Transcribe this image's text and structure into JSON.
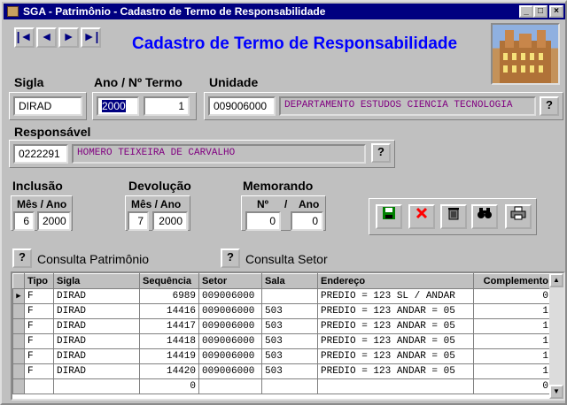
{
  "window": {
    "title": "SGA - Patrimônio - Cadastro de Termo de Responsabilidade",
    "controls": {
      "minimize": "_",
      "maximize": "□",
      "close": "×"
    }
  },
  "nav": {
    "first": "|◄",
    "prev": "◄",
    "next": "►",
    "last": "►|"
  },
  "heading": "Cadastro de Termo de Responsabilidade",
  "form": {
    "sigla_label": "Sigla",
    "sigla_value": "DIRAD",
    "ano_termo_label": "Ano  /  Nº Termo",
    "ano_value": "2000",
    "termo_value": "1",
    "unidade_label": "Unidade",
    "unidade_code": "009006000",
    "unidade_name": "DEPARTAMENTO ESTUDOS CIENCIA TECNOLOGIA",
    "responsavel_label": "Responsável",
    "responsavel_code": "0222291",
    "responsavel_name": "HOMERO TEIXEIRA DE CARVALHO",
    "inclusao_label": "Inclusão",
    "inclusao_sub": "Mês / Ano",
    "inclusao_mes": "6",
    "inclusao_ano": "2000",
    "devolucao_label": "Devolução",
    "devolucao_sub": "Mês / Ano",
    "devolucao_mes": "7",
    "devolucao_ano": "2000",
    "memorando_label": "Memorando",
    "memorando_sub_n": "Nº",
    "memorando_sub_sep": "/",
    "memorando_sub_ano": "Ano",
    "memorando_n": "0",
    "memorando_ano": "0",
    "help_glyph": "?"
  },
  "actions": {
    "save": "save-icon",
    "delete": "delete-icon",
    "trash": "trash-icon",
    "search": "binoculars-icon",
    "print": "printer-icon"
  },
  "links": {
    "consulta_patrimonio": "Consulta Patrimônio",
    "consulta_setor": "Consulta Setor"
  },
  "table": {
    "columns": [
      "Tipo",
      "Sigla",
      "Sequência",
      "Setor",
      "Sala",
      "Endereço",
      "Complemento"
    ],
    "rows": [
      [
        "F",
        "DIRAD",
        "6989",
        "009006000",
        "",
        "PREDIO = 123  SL / ANDAR",
        "0"
      ],
      [
        "F",
        "DIRAD",
        "14416",
        "009006000",
        "503",
        "PREDIO = 123  ANDAR = 05",
        "1"
      ],
      [
        "F",
        "DIRAD",
        "14417",
        "009006000",
        "503",
        "PREDIO = 123  ANDAR = 05",
        "1"
      ],
      [
        "F",
        "DIRAD",
        "14418",
        "009006000",
        "503",
        "PREDIO = 123  ANDAR = 05",
        "1"
      ],
      [
        "F",
        "DIRAD",
        "14419",
        "009006000",
        "503",
        "PREDIO = 123  ANDAR = 05",
        "1"
      ],
      [
        "F",
        "DIRAD",
        "14420",
        "009006000",
        "503",
        "PREDIO = 123  ANDAR = 05",
        "1"
      ]
    ],
    "new_row": {
      "sequencia": "0",
      "complemento": "0"
    },
    "current_row_marker": "▶"
  },
  "colors": {
    "titlebar": "#000080",
    "heading": "#0000ff",
    "readonly_text": "#800080"
  }
}
